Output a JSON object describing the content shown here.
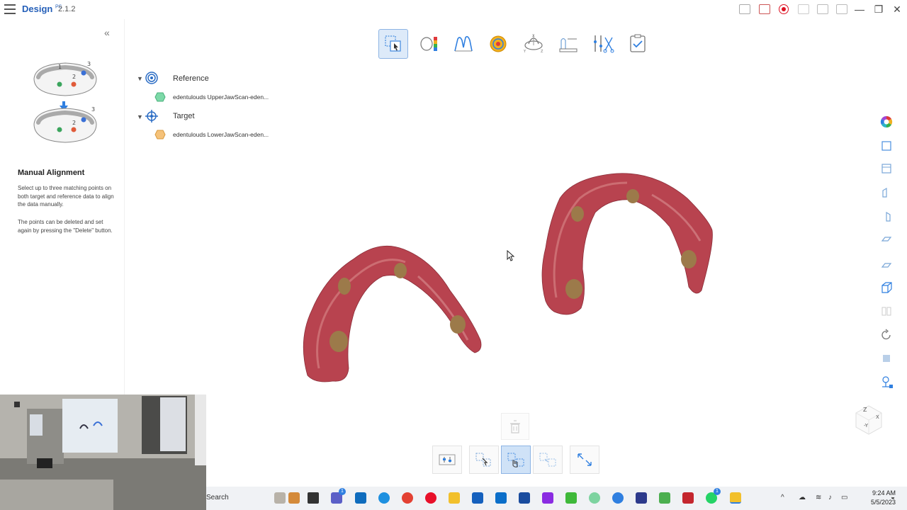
{
  "titlebar": {
    "app_name": "Design",
    "app_superscript": "PS",
    "version": "2.1.2",
    "minimize": "—",
    "maximize": "❐",
    "close": "✕"
  },
  "left_panel": {
    "collapse_glyph": "«",
    "illustration": {
      "step1": "1",
      "step2": "2",
      "step3": "3"
    },
    "title": "Manual Alignment",
    "desc1": "Select up to three matching points on both target and reference data to align the data manually.",
    "desc2": "The points can be deleted and set again by pressing the \"Delete\" button."
  },
  "tree": {
    "reference": {
      "label": "Reference",
      "item": "edentulouds UpperJawScan-eden...",
      "item_color": "#7dd9a8"
    },
    "target": {
      "label": "Target",
      "item": "edentulouds LowerJawScan-eden...",
      "item_color": "#f5c27a"
    }
  },
  "top_toolbar": [
    {
      "icon": "manual-align-icon",
      "active": true
    },
    {
      "icon": "deviation-map-icon",
      "active": false
    },
    {
      "icon": "cross-section-icon",
      "active": false
    },
    {
      "icon": "occlusion-icon",
      "active": false
    },
    {
      "icon": "axis-rotate-icon",
      "active": false
    },
    {
      "icon": "measure-icon",
      "active": false
    },
    {
      "icon": "trim-tools-icon",
      "active": false
    },
    {
      "icon": "finish-check-icon",
      "active": false
    }
  ],
  "orientation_cube": {
    "z": "Z",
    "x": "X",
    "neg_y": "-Y"
  },
  "taskbar": {
    "search": "Search",
    "time": "9:24 AM",
    "date": "5/5/2023",
    "badge": "1"
  },
  "colors": {
    "accent": "#2660b9",
    "active_bg": "#ddeaf9",
    "gum": "#b8434f",
    "implant": "#9c7a4a"
  }
}
